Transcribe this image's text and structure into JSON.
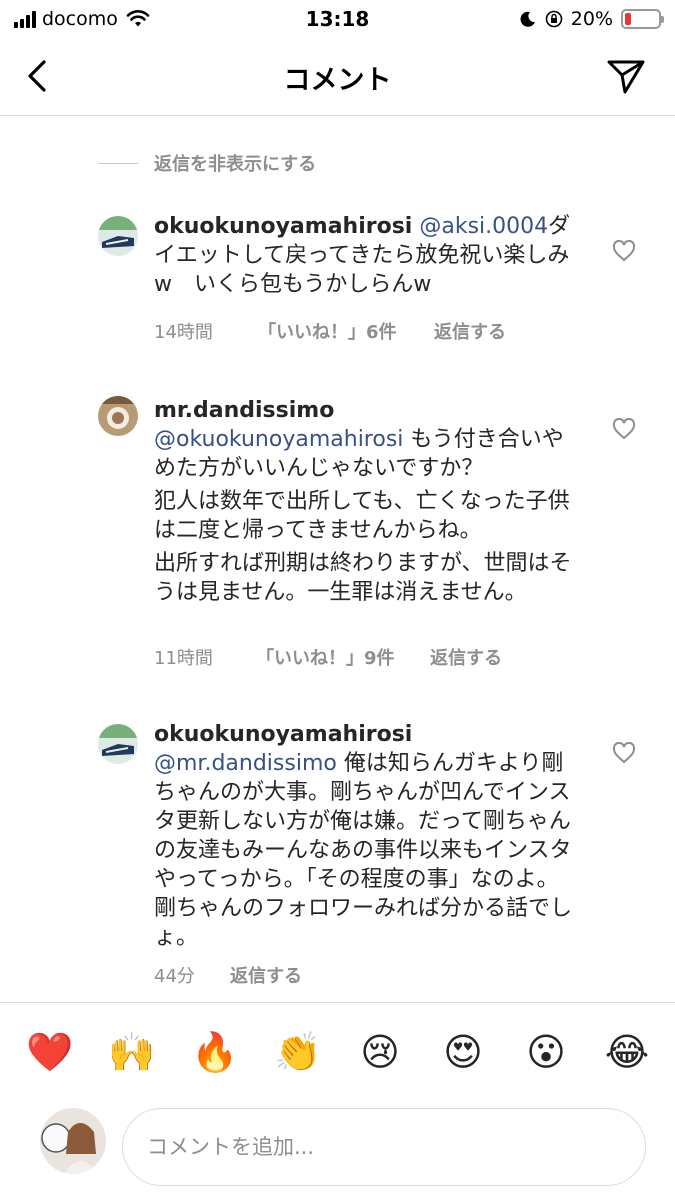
{
  "status_bar": {
    "carrier": "docomo",
    "time": "13:18",
    "battery_percent": "20%",
    "battery_level": 0.2
  },
  "nav": {
    "title": "コメント"
  },
  "hide_replies_label": "返信を非表示にする",
  "comments": [
    {
      "username": "okuokunoyamahirosi",
      "mention": "@aksi.0004",
      "lines": [
        "ダイエットして戻ってきたら放免祝い楽しみw　いくら包もうかしらんw"
      ],
      "time": "14時間",
      "likes": "「いいね！」6件",
      "reply_label": "返信する"
    },
    {
      "username": "mr.dandissimo",
      "mention": "@okuokunoyamahirosi",
      "lines": [
        "もう付き合いやめた方がいいんじゃないですか？",
        "犯人は数年で出所しても、亡くなった子供は二度と帰ってきませんからね。",
        "出所すれば刑期は終わりますが、世間はそうは見ません。一生罪は消えません。"
      ],
      "time": "11時間",
      "likes": "「いいね！」9件",
      "reply_label": "返信する"
    },
    {
      "username": "okuokunoyamahirosi",
      "mention": "@mr.dandissimo",
      "lines": [
        "俺は知らんガキより剛ちゃんのが大事。剛ちゃんが凹んでインスタ更新しない方が俺は嫌。だって剛ちゃんの友達もみーんなあの事件以来もインスタやってっから。「その程度の事」なのよ。剛ちゃんのフォロワーみれば分かる話でしょ。"
      ],
      "time": "44分",
      "reply_label": "返信する"
    }
  ],
  "emoji_bar": [
    "❤️",
    "🙌",
    "🔥",
    "👏",
    "😢",
    "😍",
    "😮",
    "😂"
  ],
  "input": {
    "placeholder": "コメントを追加..."
  }
}
